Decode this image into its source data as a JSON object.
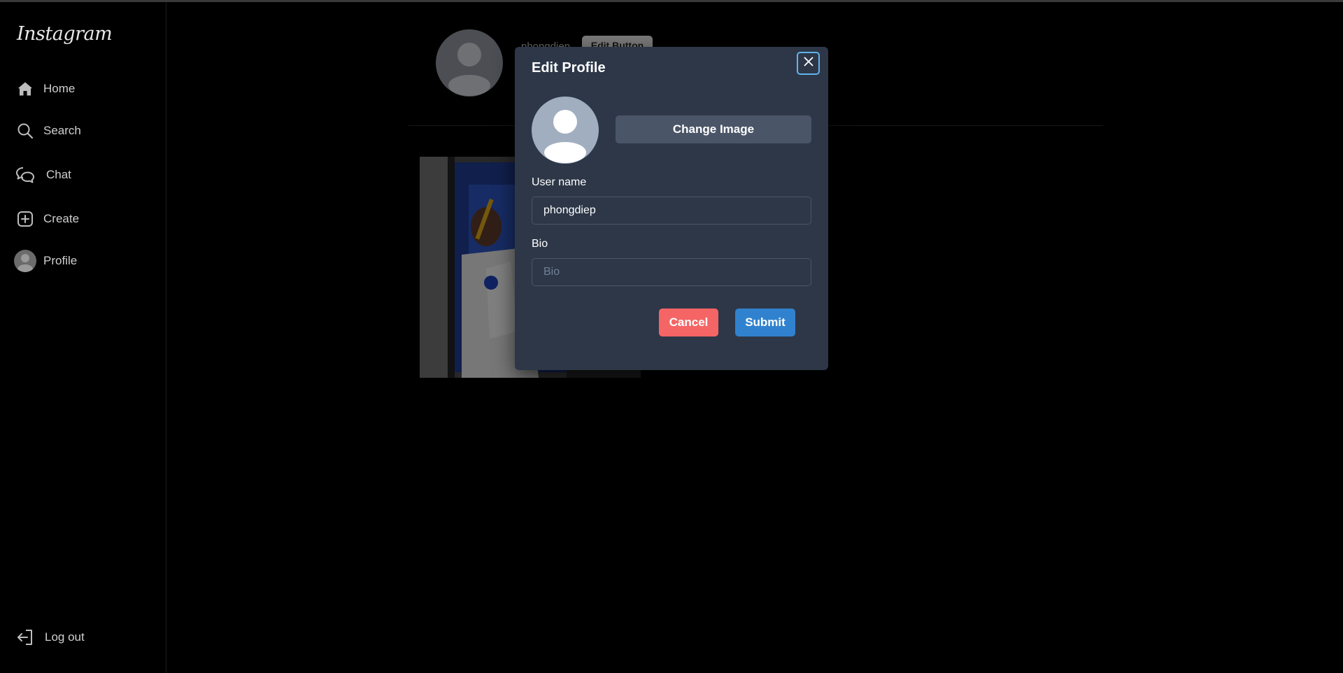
{
  "sidebar": {
    "logo": "Instagram",
    "items": [
      {
        "label": "Home",
        "icon": "home-icon"
      },
      {
        "label": "Search",
        "icon": "search-icon"
      },
      {
        "label": "Chat",
        "icon": "chat-icon"
      },
      {
        "label": "Create",
        "icon": "plus-square-icon"
      },
      {
        "label": "Profile",
        "icon": "avatar"
      }
    ],
    "logout": {
      "label": "Log out",
      "icon": "logout-icon"
    }
  },
  "profile": {
    "username": "phongdiep",
    "edit_button": "Edit Button"
  },
  "modal": {
    "title": "Edit Profile",
    "change_image": "Change Image",
    "username_label": "User name",
    "username_value": "phongdiep",
    "bio_label": "Bio",
    "bio_placeholder": "Bio",
    "cancel": "Cancel",
    "submit": "Submit"
  },
  "colors": {
    "modal_bg": "#2d3748",
    "cancel": "#f56565",
    "submit": "#3182ce",
    "change_image": "#4a5568",
    "focus_ring": "#63b3ed"
  }
}
